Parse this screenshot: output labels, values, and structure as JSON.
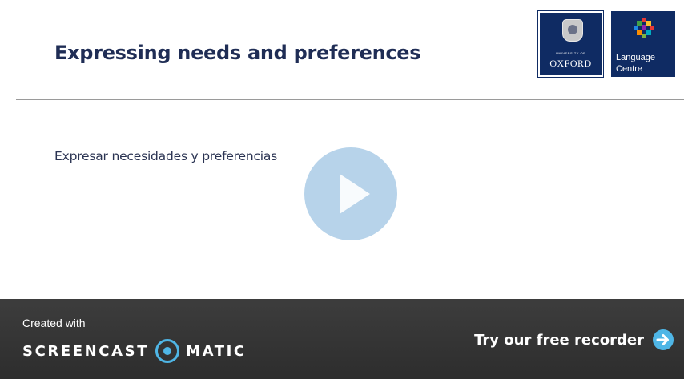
{
  "slide": {
    "title": "Expressing needs and preferences",
    "subtitle": "Expresar necesidades y preferencias"
  },
  "logos": {
    "oxford": {
      "small_text": "UNIVERSITY OF",
      "big_text": "OXFORD",
      "icon": "crest-icon"
    },
    "language_centre": {
      "line1": "Language",
      "line2": "Centre",
      "icon": "mosaic-icon"
    }
  },
  "player": {
    "icon": "play-icon"
  },
  "watermark": {
    "created_with": "Created with",
    "brand_left": "SCREENCAST",
    "brand_right": "MATIC",
    "cta_label": "Try our free recorder",
    "cta_icon": "arrow-right-circle-icon",
    "accent_color": "#4fb6e6",
    "bar_color": "#333333"
  },
  "colors": {
    "title": "#1f2d55",
    "logo_bg": "#0f2b63"
  }
}
